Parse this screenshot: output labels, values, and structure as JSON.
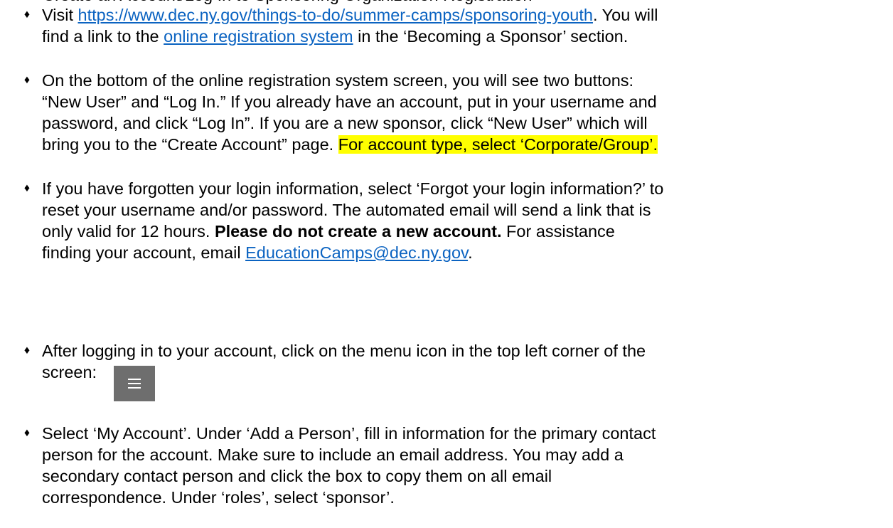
{
  "top_cut_text": "Create an Account/Log In to Sponsoring Organization Registration",
  "bullet_symbol": "♦",
  "items": [
    {
      "line1_before": "Visit ",
      "line1_link": "https://www.dec.ny.gov/things-to-do/summer-camps/sponsoring-youth",
      "line1_after": ". You will",
      "line2_before": "find a link to the ",
      "line2_link": "online registration system",
      "line2_after": " in the ‘Becoming a Sponsor’ section."
    },
    {
      "line1": "On the bottom of the online registration system screen, you will see two buttons:",
      "line2": "“New User” and “Log In.” If you already have an account, put in your username and",
      "line3": "password, and click “Log In”. If you are a new sponsor, click “New User” which will",
      "line4_before": "bring you to the “Create Account” page. ",
      "line4_highlight": "For account type, select ‘Corporate/Group’."
    },
    {
      "line1": "If you have forgotten your login information, select ‘Forgot your login information?’ to",
      "line2": "reset your username and/or password. The automated email will send a link that is",
      "line3_before": "only valid for 12 hours. ",
      "line3_bold": "Please do not create a new account.",
      "line3_after": " For assistance",
      "line4_before": "finding your account, email ",
      "line4_link": "EducationCamps@dec.ny.gov",
      "line4_after": "."
    },
    {
      "line1": "After logging in to your account, click on the menu icon in the top left corner of the",
      "line2": "screen:"
    },
    {
      "line1": "Select ‘My Account’. Under ‘Add a Person’, fill in information for the primary contact",
      "line2": "person for the account. Make sure to include an email address. You may add a",
      "line3": "secondary contact person and click the box to copy them on all email",
      "line4": "correspondence. Under ‘roles’, select ‘sponsor’."
    }
  ],
  "colors": {
    "link": "#0b63c1",
    "highlight": "#ffff00",
    "menu_icon_bg": "#6e6e6e"
  }
}
